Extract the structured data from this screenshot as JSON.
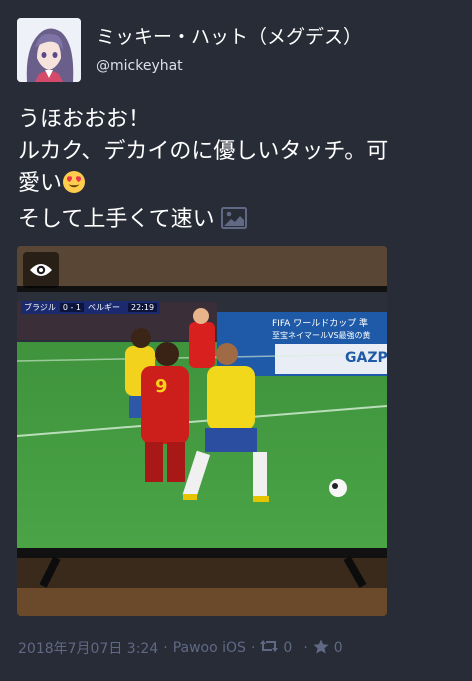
{
  "status": {
    "display_name": "ミッキー・ハット（メグデス）",
    "username": "@mickeyhat",
    "content": {
      "line1": "うほおおお！",
      "line2": "ルカク、デカイのに優しいタッチ。可",
      "line3": "愛い",
      "line4": "そして上手くて速い"
    },
    "emoji": "heart-eyes-emoji",
    "media": {
      "tv_score_team1": "ブラジル",
      "tv_score": "0 - 1",
      "tv_score_team2": "ベルギー",
      "tv_clock": "22:19",
      "banner_title": "FIFA ワールドカップ 準",
      "banner_sub": "至宝ネイマールVS最強の黄",
      "board": "GAZP",
      "player_number": "9"
    },
    "meta": {
      "timestamp": "2018年7月07日 3:24",
      "app": "Pawoo iOS",
      "boosts": "0",
      "favourites": "0",
      "separator": "·"
    }
  },
  "colors": {
    "background": "#282c37",
    "text": "#ffffff",
    "meta": "#606984",
    "pitch": "#3f9a3d"
  }
}
